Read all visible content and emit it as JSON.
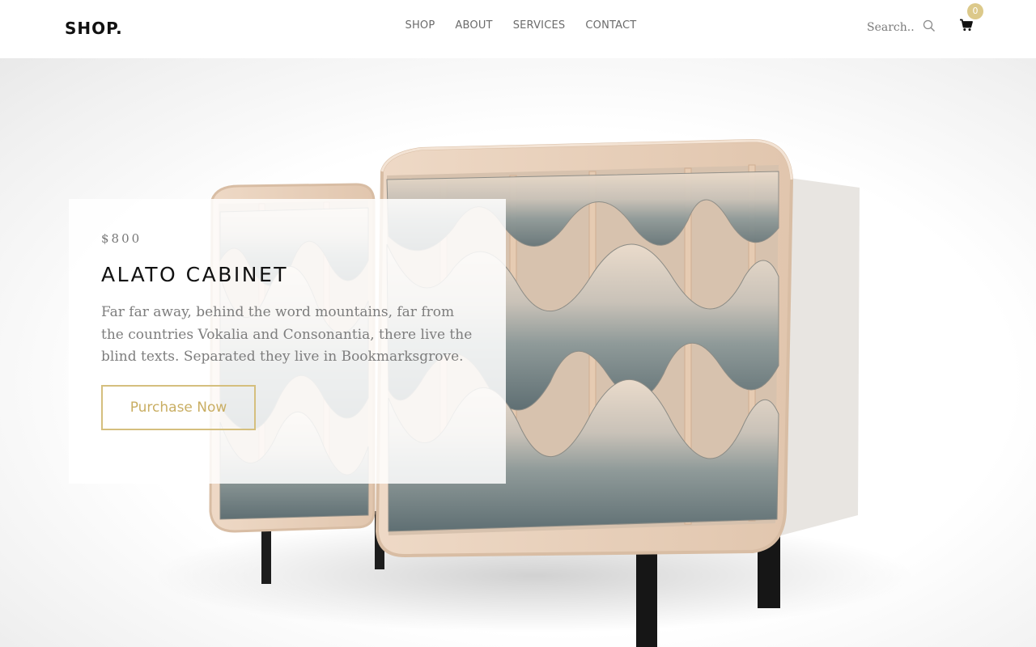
{
  "header": {
    "logo": "SHOP.",
    "nav": [
      {
        "label": "SHOP"
      },
      {
        "label": "ABOUT"
      },
      {
        "label": "SERVICES"
      },
      {
        "label": "CONTACT"
      }
    ],
    "search": {
      "placeholder": "Search.."
    },
    "cart": {
      "count": "0",
      "icon": "cart-icon"
    }
  },
  "hero": {
    "price": "$800",
    "title": "ALATO CABINET",
    "description": "Far far away, behind the word mountains, far from the countries Vokalia and Consonantia, there live the blind texts. Separated they live in Bookmarksgrove.",
    "cta_label": "Purchase Now",
    "image": "cabinet-product-image"
  },
  "colors": {
    "accent": "#d5bf7e",
    "badge": "#dcc98a",
    "text_dark": "#111111",
    "text_muted": "#7d7d7d",
    "cabinet_wood": "#e9d2bf",
    "cabinet_slate": "#6f7f82"
  }
}
